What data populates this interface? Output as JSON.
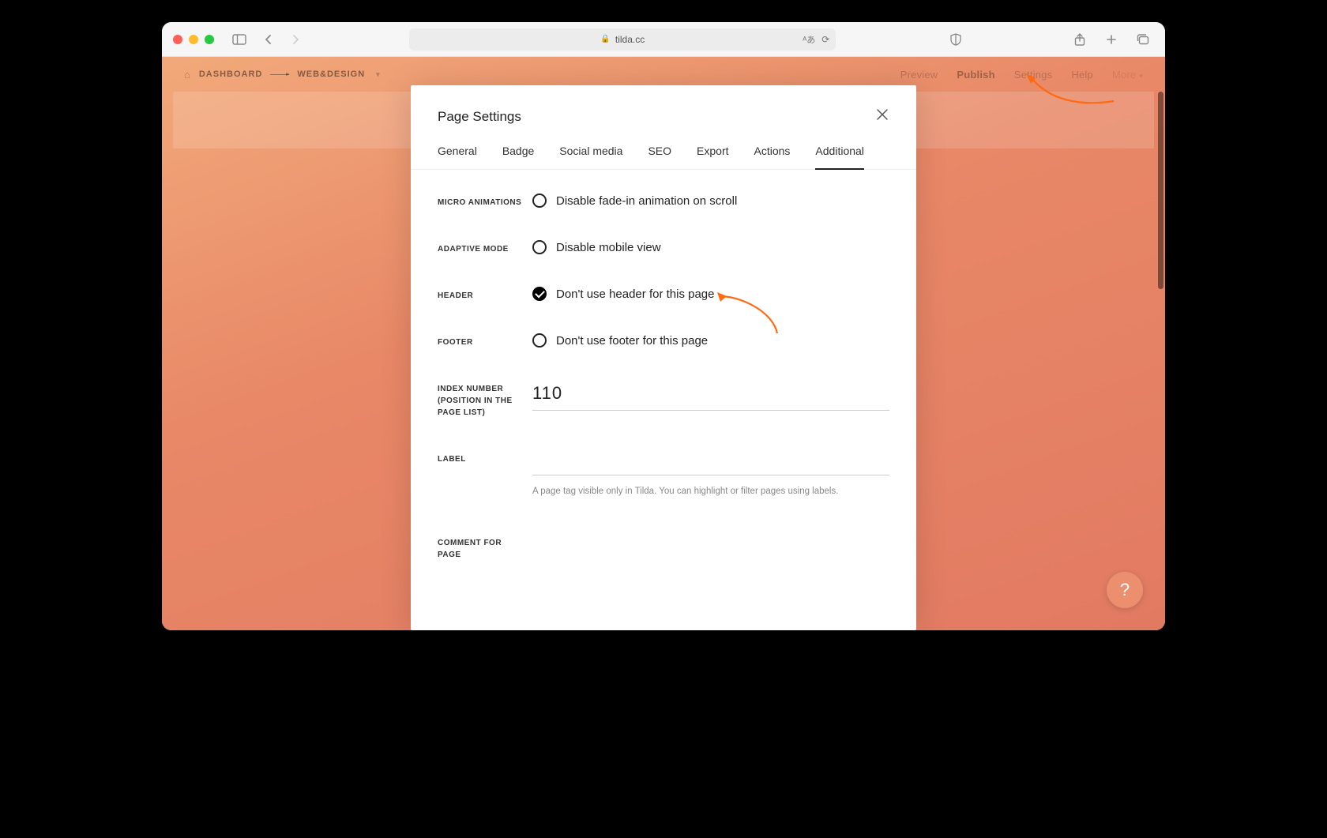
{
  "browser": {
    "url_host": "tilda.cc"
  },
  "app_header": {
    "dashboard_label": "DASHBOARD",
    "project_label": "WEB&DESIGN",
    "nav": {
      "preview": "Preview",
      "publish": "Publish",
      "settings": "Settings",
      "help": "Help",
      "more": "More"
    }
  },
  "modal": {
    "title": "Page Settings",
    "tabs": {
      "general": "General",
      "badge": "Badge",
      "social": "Social media",
      "seo": "SEO",
      "export": "Export",
      "actions": "Actions",
      "additional": "Additional"
    },
    "active_tab": "additional",
    "sections": {
      "micro_anim": {
        "label": "MICRO ANIMATIONS",
        "option": "Disable fade-in animation on scroll",
        "checked": false
      },
      "adaptive": {
        "label": "ADAPTIVE MODE",
        "option": "Disable mobile view",
        "checked": false
      },
      "header": {
        "label": "HEADER",
        "option": "Don't use header for this page",
        "checked": true
      },
      "footer": {
        "label": "FOOTER",
        "option": "Don't use footer for this page",
        "checked": false
      },
      "index": {
        "label": "INDEX NUMBER (POSITION IN THE PAGE LIST)",
        "value": "110"
      },
      "label_field": {
        "label": "LABEL",
        "value": "",
        "hint": "A page tag visible only in Tilda. You can highlight or filter pages using labels."
      },
      "comments": {
        "label": "COMMENT FOR PAGE",
        "value": ""
      }
    }
  },
  "fab": {
    "glyph": "?"
  }
}
